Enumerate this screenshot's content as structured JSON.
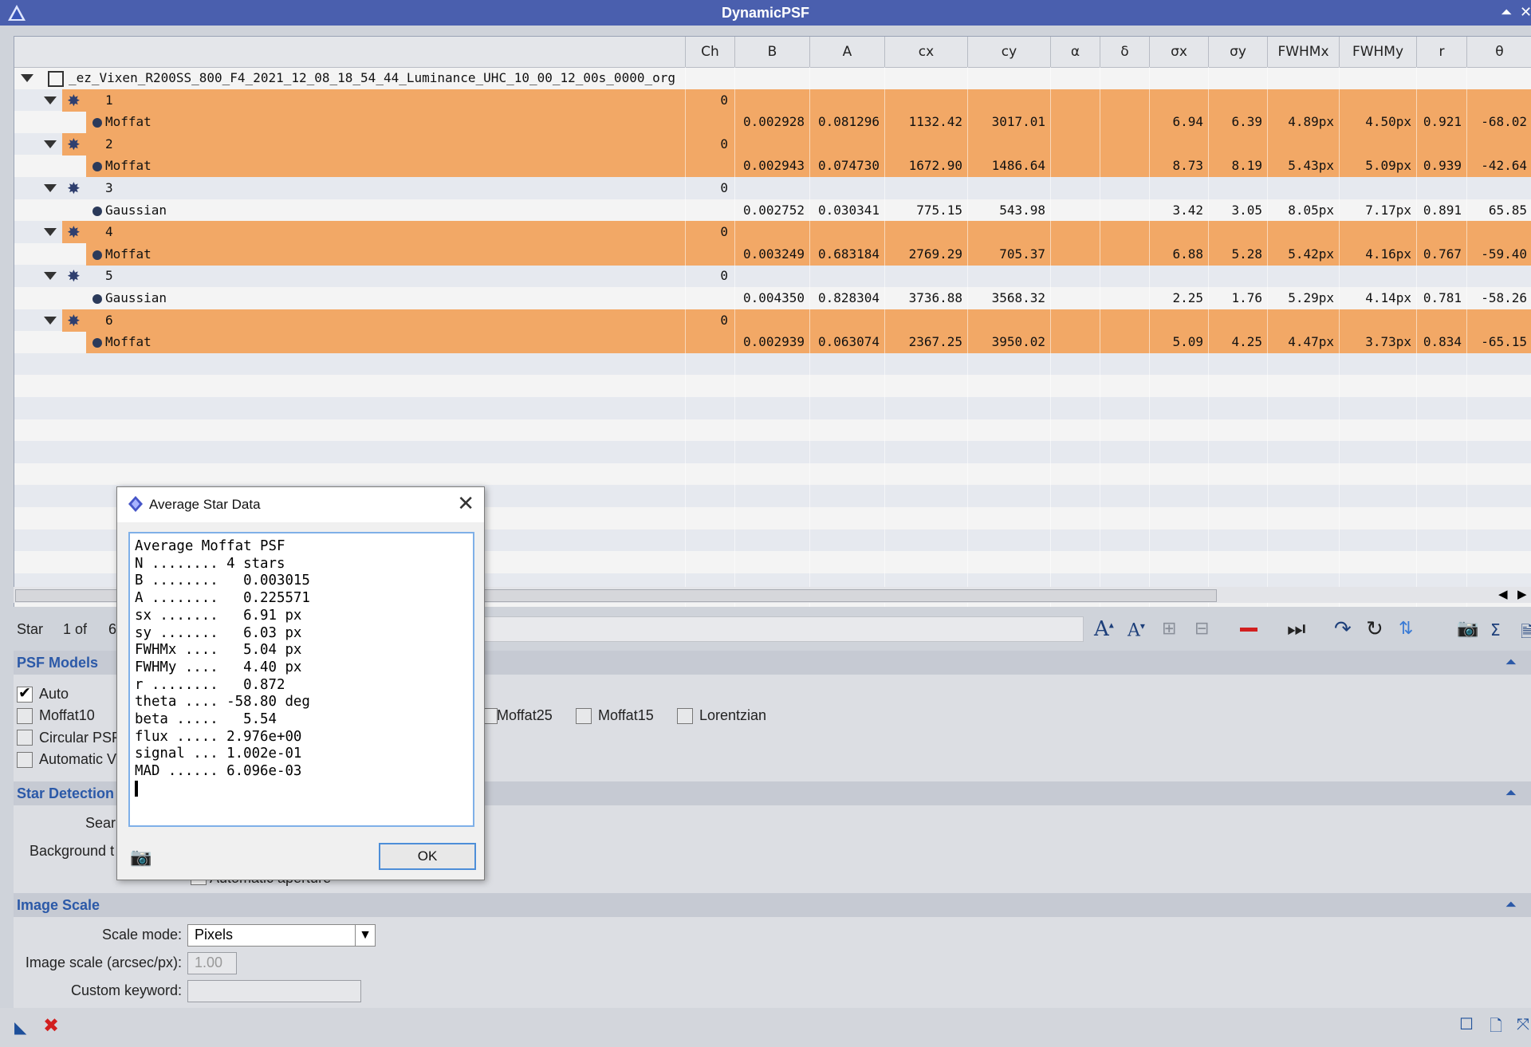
{
  "window": {
    "title": "DynamicPSF"
  },
  "table": {
    "columns": [
      "",
      "Ch",
      "B",
      "A",
      "cx",
      "cy",
      "α",
      "δ",
      "σx",
      "σy",
      "FWHMx",
      "FWHMy",
      "r",
      "θ"
    ],
    "image_name": "_ez_Vixen_R200SS_800_F4_2021_12_08_18_54_44_Luminance_UHC_10_00_12_00s_0000_org",
    "stars": [
      {
        "id": "1",
        "ch": "0",
        "model": "Moffat",
        "b": "0.002928",
        "a": "0.081296",
        "cx": "1132.42",
        "cy": "3017.01",
        "sx": "6.94",
        "sy": "6.39",
        "fwhmx": "4.89px",
        "fwhmy": "4.50px",
        "r": "0.921",
        "theta": "-68.02"
      },
      {
        "id": "2",
        "ch": "0",
        "model": "Moffat",
        "b": "0.002943",
        "a": "0.074730",
        "cx": "1672.90",
        "cy": "1486.64",
        "sx": "8.73",
        "sy": "8.19",
        "fwhmx": "5.43px",
        "fwhmy": "5.09px",
        "r": "0.939",
        "theta": "-42.64"
      },
      {
        "id": "3",
        "ch": "0",
        "model": "Gaussian",
        "b": "0.002752",
        "a": "0.030341",
        "cx": "775.15",
        "cy": "543.98",
        "sx": "3.42",
        "sy": "3.05",
        "fwhmx": "8.05px",
        "fwhmy": "7.17px",
        "r": "0.891",
        "theta": "65.85"
      },
      {
        "id": "4",
        "ch": "0",
        "model": "Moffat",
        "b": "0.003249",
        "a": "0.683184",
        "cx": "2769.29",
        "cy": "705.37",
        "sx": "6.88",
        "sy": "5.28",
        "fwhmx": "5.42px",
        "fwhmy": "4.16px",
        "r": "0.767",
        "theta": "-59.40"
      },
      {
        "id": "5",
        "ch": "0",
        "model": "Gaussian",
        "b": "0.004350",
        "a": "0.828304",
        "cx": "3736.88",
        "cy": "3568.32",
        "sx": "2.25",
        "sy": "1.76",
        "fwhmx": "5.29px",
        "fwhmy": "4.14px",
        "r": "0.781",
        "theta": "-58.26"
      },
      {
        "id": "6",
        "ch": "0",
        "model": "Moffat",
        "b": "0.002939",
        "a": "0.063074",
        "cx": "2367.25",
        "cy": "3950.02",
        "sx": "5.09",
        "sy": "4.25",
        "fwhmx": "4.47px",
        "fwhmy": "3.73px",
        "r": "0.834",
        "theta": "-65.15"
      }
    ]
  },
  "toolbar": {
    "star_label": "Star",
    "counter": "1 of",
    "counter_total": "6"
  },
  "psf_models": {
    "title": "PSF Models",
    "options": [
      {
        "label": "Auto",
        "checked": true
      },
      {
        "label": "Moffat10",
        "checked": false
      },
      {
        "label": "Circular PSF",
        "checked": false
      },
      {
        "label": "Automatic V",
        "checked": false
      }
    ],
    "row2_extra": [
      {
        "label": "Moffat25",
        "checked": false
      },
      {
        "label": "Moffat15",
        "checked": false
      },
      {
        "label": "Lorentzian",
        "checked": false
      }
    ]
  },
  "star_detection": {
    "title": "Star Detection",
    "search_label": "Sear",
    "background_label": "Background t",
    "aperture_label": "Automatic aperture"
  },
  "image_scale": {
    "title": "Image Scale",
    "scale_mode_label": "Scale mode:",
    "scale_mode_value": "Pixels",
    "image_scale_label": "Image scale (arcsec/px):",
    "image_scale_value": "1.00",
    "custom_keyword_label": "Custom keyword:",
    "custom_keyword_value": ""
  },
  "dialog": {
    "title": "Average Star Data",
    "text": "Average Moffat PSF\nN ........ 4 stars\nB ........   0.003015\nA ........   0.225571\nsx .......   6.91 px\nsy .......   6.03 px\nFWHMx ....   5.04 px\nFWHMy ....   4.40 px\nr ........   0.872\ntheta .... -58.80 deg\nbeta .....   5.54\nflux ..... 2.976e+00\nsignal ... 1.002e-01\nMAD ...... 6.096e-03\n",
    "ok_label": "OK"
  },
  "colors": {
    "titlebar": "#4a5fae",
    "selected_row": "#f2a866",
    "section_title": "#2b59a8"
  }
}
